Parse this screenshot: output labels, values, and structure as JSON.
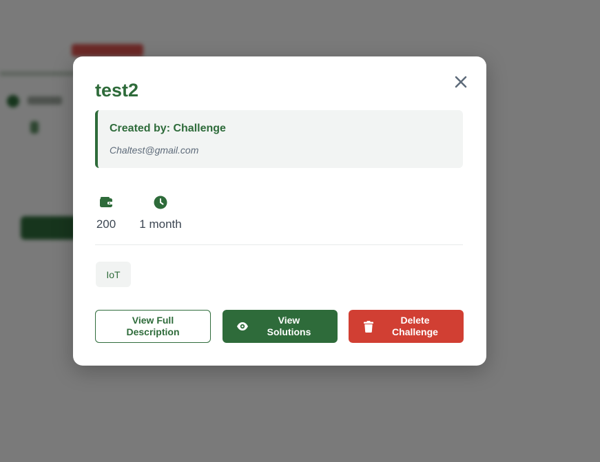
{
  "modal": {
    "title": "test2",
    "creator_label": "Created by: Challenge",
    "creator_email": "Chaltest@gmail.com",
    "close_icon": "close-icon",
    "stats": {
      "points": {
        "icon": "wallet-icon",
        "value": "200"
      },
      "duration": {
        "icon": "clock-icon",
        "value": "1 month"
      }
    },
    "tags": [
      "IoT"
    ],
    "buttons": {
      "view_description": "View Full Description",
      "view_solutions": "View Solutions",
      "delete_challenge": "Delete Challenge"
    }
  },
  "colors": {
    "primary_green": "#2e6b3a",
    "danger_red": "#d13f33",
    "overlay": "rgba(0,0,0,0.5)"
  }
}
